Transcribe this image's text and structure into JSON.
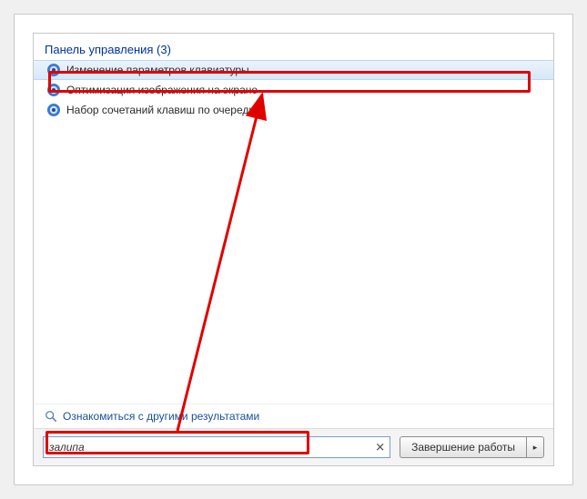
{
  "category": {
    "header": "Панель управления (3)"
  },
  "results": [
    {
      "label": "Изменение параметров клавиатуры"
    },
    {
      "label": "Оптимизация изображения на экране"
    },
    {
      "label": "Набор сочетаний клавиш по очереди"
    }
  ],
  "see_more": "Ознакомиться с другими результатами",
  "search": {
    "value": "залипа",
    "clear": "✕"
  },
  "shutdown": {
    "label": "Завершение работы",
    "arrow": "▸"
  },
  "icons": {
    "cp": "control-panel-icon",
    "mag": "magnifier-icon"
  }
}
